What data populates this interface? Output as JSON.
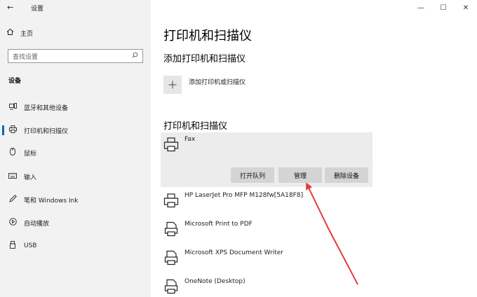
{
  "window": {
    "back_glyph": "←",
    "title": "设置",
    "minimize": "—",
    "maximize": "☐",
    "close": "✕"
  },
  "sidebar": {
    "home": {
      "icon": "home-icon",
      "label": "主页"
    },
    "search": {
      "placeholder": "查找设置"
    },
    "section": "设备",
    "items": [
      {
        "icon": "bluetooth-devices-icon",
        "label": "蓝牙和其他设备",
        "selected": false
      },
      {
        "icon": "printer-icon",
        "label": "打印机和扫描仪",
        "selected": true
      },
      {
        "icon": "mouse-icon",
        "label": "鼠标",
        "selected": false
      },
      {
        "icon": "keyboard-icon",
        "label": "输入",
        "selected": false
      },
      {
        "icon": "pen-icon",
        "label": "笔和 Windows Ink",
        "selected": false
      },
      {
        "icon": "autoplay-icon",
        "label": "自动播放",
        "selected": false
      },
      {
        "icon": "usb-icon",
        "label": "USB",
        "selected": false
      }
    ]
  },
  "main": {
    "title": "打印机和扫描仪",
    "add_section_title": "添加打印机和扫描仪",
    "add_label": "添加打印机或扫描仪",
    "list_title": "打印机和扫描仪",
    "printers": [
      {
        "name": "Fax",
        "selected": true
      },
      {
        "name": "HP LaserJet Pro MFP M128fw[5A18F8]",
        "selected": false
      },
      {
        "name": "Microsoft Print to PDF",
        "selected": false
      },
      {
        "name": "Microsoft XPS Document Writer",
        "selected": false
      },
      {
        "name": "OneNote (Desktop)",
        "selected": false
      }
    ],
    "buttons": {
      "open_queue": "打开队列",
      "manage": "管理",
      "remove": "删除设备"
    }
  },
  "colors": {
    "sidebar_bg": "#f2f2f2",
    "accent": "#0067c0",
    "card_bg": "#ececec",
    "button_bg": "#d4d4d4",
    "annotation": "#e8393a"
  }
}
